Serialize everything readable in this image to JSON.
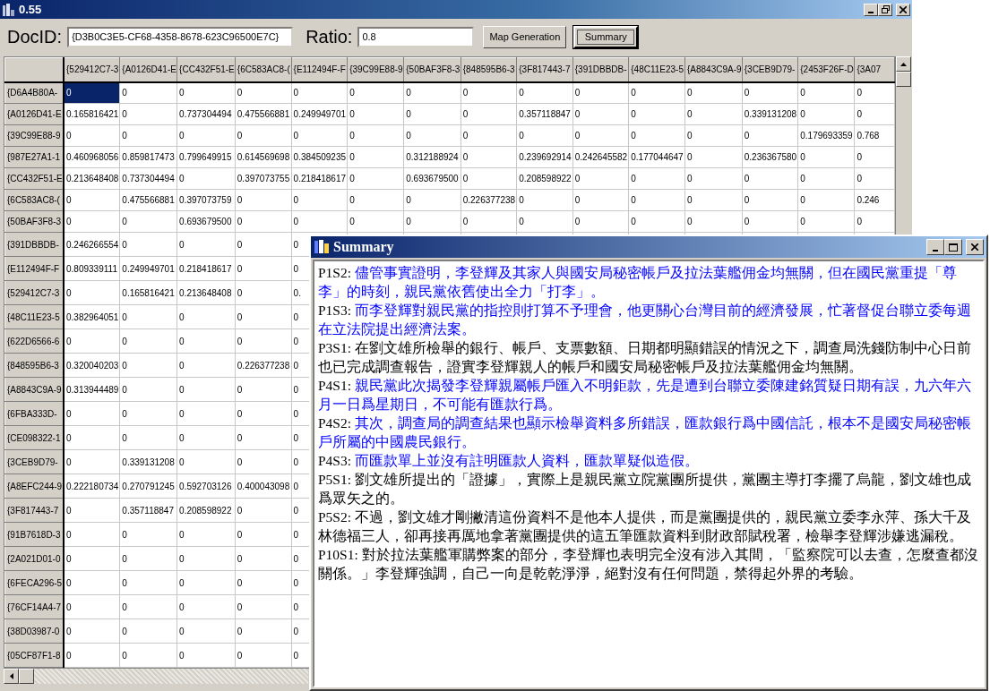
{
  "window": {
    "title": "0.55"
  },
  "toolbar": {
    "docid_label": "DocID:",
    "docid_value": "{D3B0C3E5-CF68-4358-8678-623C96500E7C}",
    "ratio_label": "Ratio:",
    "ratio_value": "0.8",
    "buttons": [
      {
        "label": "Map Generation",
        "focused": false
      },
      {
        "label": "Summary",
        "focused": true
      }
    ]
  },
  "grid": {
    "columns": [
      "{529412C7-3",
      "{A0126D41-E",
      "{CC432F51-E",
      "{6C583AC8-(",
      "{E112494F-F",
      "{39C99E88-9",
      "{50BAF3F8-3",
      "{848595B6-3",
      "{3F817443-7",
      "{391DBBDB-",
      "{48C11E23-5",
      "{A8843C9A-9",
      "{3CEB9D79-",
      "{2453F26F-D",
      "{3A07"
    ],
    "rows": [
      {
        "header": "{D6A4B80A-",
        "cells": [
          {
            "text": "0",
            "selected": true
          },
          {
            "text": "0",
            "selected": false
          },
          {
            "text": "0",
            "selected": false
          },
          {
            "text": "0",
            "selected": false
          },
          {
            "text": "0",
            "selected": false
          },
          {
            "text": "0",
            "selected": false
          },
          {
            "text": "0",
            "selected": false
          },
          {
            "text": "0",
            "selected": false
          },
          {
            "text": "0",
            "selected": false
          },
          {
            "text": "0",
            "selected": false
          },
          {
            "text": "0",
            "selected": false
          },
          {
            "text": "0",
            "selected": false
          },
          {
            "text": "0",
            "selected": false
          },
          {
            "text": "0",
            "selected": false
          },
          {
            "text": "0",
            "selected": false
          }
        ]
      },
      {
        "header": "{A0126D41-E",
        "cells": [
          {
            "text": "0.165816421",
            "selected": false
          },
          {
            "text": "0",
            "selected": false
          },
          {
            "text": "0.737304494",
            "selected": false
          },
          {
            "text": "0.475566881",
            "selected": false
          },
          {
            "text": "0.249949701",
            "selected": false
          },
          {
            "text": "0",
            "selected": false
          },
          {
            "text": "0",
            "selected": false
          },
          {
            "text": "0",
            "selected": false
          },
          {
            "text": "0.357118847",
            "selected": false
          },
          {
            "text": "0",
            "selected": false
          },
          {
            "text": "0",
            "selected": false
          },
          {
            "text": "0",
            "selected": false
          },
          {
            "text": "0.339131208",
            "selected": false
          },
          {
            "text": "0",
            "selected": false
          },
          {
            "text": "0",
            "selected": false
          }
        ]
      },
      {
        "header": "{39C99E88-9",
        "cells": [
          {
            "text": "0",
            "selected": false
          },
          {
            "text": "0",
            "selected": false
          },
          {
            "text": "0",
            "selected": false
          },
          {
            "text": "0",
            "selected": false
          },
          {
            "text": "0",
            "selected": false
          },
          {
            "text": "0",
            "selected": false
          },
          {
            "text": "0",
            "selected": false
          },
          {
            "text": "0",
            "selected": false
          },
          {
            "text": "0",
            "selected": false
          },
          {
            "text": "0",
            "selected": false
          },
          {
            "text": "0",
            "selected": false
          },
          {
            "text": "0",
            "selected": false
          },
          {
            "text": "0",
            "selected": false
          },
          {
            "text": "0.179693359",
            "selected": false
          },
          {
            "text": "0.768",
            "selected": false
          }
        ]
      },
      {
        "header": "{987E27A1-1",
        "cells": [
          {
            "text": "0.460968056",
            "selected": false
          },
          {
            "text": "0.859817473",
            "selected": false
          },
          {
            "text": "0.799649915",
            "selected": false
          },
          {
            "text": "0.614569698",
            "selected": false
          },
          {
            "text": "0.384509235",
            "selected": false
          },
          {
            "text": "0",
            "selected": false
          },
          {
            "text": "0.312188924",
            "selected": false
          },
          {
            "text": "0",
            "selected": false
          },
          {
            "text": "0.239692914",
            "selected": false
          },
          {
            "text": "0.242645582",
            "selected": false
          },
          {
            "text": "0.177044647",
            "selected": false
          },
          {
            "text": "0",
            "selected": false
          },
          {
            "text": "0.236367580",
            "selected": false
          },
          {
            "text": "0",
            "selected": false
          },
          {
            "text": "0",
            "selected": false
          }
        ]
      },
      {
        "header": "{CC432F51-E",
        "cells": [
          {
            "text": "0.213648408",
            "selected": false
          },
          {
            "text": "0.737304494",
            "selected": false
          },
          {
            "text": "0",
            "selected": false
          },
          {
            "text": "0.397073755",
            "selected": false
          },
          {
            "text": "0.218418617",
            "selected": false
          },
          {
            "text": "0",
            "selected": false
          },
          {
            "text": "0.693679500",
            "selected": false
          },
          {
            "text": "0",
            "selected": false
          },
          {
            "text": "0.208598922",
            "selected": false
          },
          {
            "text": "0",
            "selected": false
          },
          {
            "text": "0",
            "selected": false
          },
          {
            "text": "0",
            "selected": false
          },
          {
            "text": "0",
            "selected": false
          },
          {
            "text": "0",
            "selected": false
          },
          {
            "text": "0",
            "selected": false
          }
        ]
      },
      {
        "header": "{6C583AC8-(",
        "cells": [
          {
            "text": "0",
            "selected": false
          },
          {
            "text": "0.475566881",
            "selected": false
          },
          {
            "text": "0.397073759",
            "selected": false
          },
          {
            "text": "0",
            "selected": false
          },
          {
            "text": "0",
            "selected": false
          },
          {
            "text": "0",
            "selected": false
          },
          {
            "text": "0",
            "selected": false
          },
          {
            "text": "0.226377238",
            "selected": false
          },
          {
            "text": "0",
            "selected": false
          },
          {
            "text": "0",
            "selected": false
          },
          {
            "text": "0",
            "selected": false
          },
          {
            "text": "0",
            "selected": false
          },
          {
            "text": "0",
            "selected": false
          },
          {
            "text": "0",
            "selected": false
          },
          {
            "text": "0.246",
            "selected": false
          }
        ]
      },
      {
        "header": "{50BAF3F8-3",
        "cells": [
          {
            "text": "0",
            "selected": false
          },
          {
            "text": "0",
            "selected": false
          },
          {
            "text": "0.693679500",
            "selected": false
          },
          {
            "text": "0",
            "selected": false
          },
          {
            "text": "0",
            "selected": false
          },
          {
            "text": "0",
            "selected": false
          },
          {
            "text": "0",
            "selected": false
          },
          {
            "text": "0",
            "selected": false
          },
          {
            "text": "0",
            "selected": false
          },
          {
            "text": "0",
            "selected": false
          },
          {
            "text": "0",
            "selected": false
          },
          {
            "text": "0",
            "selected": false
          },
          {
            "text": "0",
            "selected": false
          },
          {
            "text": "0",
            "selected": false
          },
          {
            "text": "0",
            "selected": false
          }
        ]
      },
      {
        "header": "{391DBBDB-",
        "cells": [
          {
            "text": "0.246266554",
            "selected": false
          },
          {
            "text": "0",
            "selected": false
          },
          {
            "text": "0",
            "selected": false
          },
          {
            "text": "0",
            "selected": false
          },
          {
            "text": "0",
            "selected": false
          }
        ]
      },
      {
        "header": "{E112494F-F",
        "cells": [
          {
            "text": "0.809339111",
            "selected": false
          },
          {
            "text": "0.249949701",
            "selected": false
          },
          {
            "text": "0.218418617",
            "selected": false
          },
          {
            "text": "0",
            "selected": false
          },
          {
            "text": "0",
            "selected": false
          }
        ]
      },
      {
        "header": "{529412C7-3",
        "cells": [
          {
            "text": "0",
            "selected": false
          },
          {
            "text": "0.165816421",
            "selected": false
          },
          {
            "text": "0.213648408",
            "selected": false
          },
          {
            "text": "0",
            "selected": false
          },
          {
            "text": "0.",
            "selected": false
          }
        ]
      },
      {
        "header": "{48C11E23-5",
        "cells": [
          {
            "text": "0.382964051",
            "selected": false
          },
          {
            "text": "0",
            "selected": false
          },
          {
            "text": "0",
            "selected": false
          },
          {
            "text": "0",
            "selected": false
          },
          {
            "text": "0",
            "selected": false
          }
        ]
      },
      {
        "header": "{622D6566-6",
        "cells": [
          {
            "text": "0",
            "selected": false
          },
          {
            "text": "0",
            "selected": false
          },
          {
            "text": "0",
            "selected": false
          },
          {
            "text": "0",
            "selected": false
          },
          {
            "text": "0",
            "selected": false
          }
        ]
      },
      {
        "header": "{848595B6-3",
        "cells": [
          {
            "text": "0.320040203",
            "selected": false
          },
          {
            "text": "0",
            "selected": false
          },
          {
            "text": "0",
            "selected": false
          },
          {
            "text": "0.226377238",
            "selected": false
          },
          {
            "text": "0",
            "selected": false
          }
        ]
      },
      {
        "header": "{A8843C9A-9",
        "cells": [
          {
            "text": "0.313944489",
            "selected": false
          },
          {
            "text": "0",
            "selected": false
          },
          {
            "text": "0",
            "selected": false
          },
          {
            "text": "0",
            "selected": false
          },
          {
            "text": "0",
            "selected": false
          }
        ]
      },
      {
        "header": "{6FBA333D-",
        "cells": [
          {
            "text": "0",
            "selected": false
          },
          {
            "text": "0",
            "selected": false
          },
          {
            "text": "0",
            "selected": false
          },
          {
            "text": "0",
            "selected": false
          },
          {
            "text": "0",
            "selected": false
          }
        ]
      },
      {
        "header": "{CE098322-1",
        "cells": [
          {
            "text": "0",
            "selected": false
          },
          {
            "text": "0",
            "selected": false
          },
          {
            "text": "0",
            "selected": false
          },
          {
            "text": "0",
            "selected": false
          },
          {
            "text": "0",
            "selected": false
          }
        ]
      },
      {
        "header": "{3CEB9D79-",
        "cells": [
          {
            "text": "0",
            "selected": false
          },
          {
            "text": "0.339131208",
            "selected": false
          },
          {
            "text": "0",
            "selected": false
          },
          {
            "text": "0",
            "selected": false
          },
          {
            "text": "0",
            "selected": false
          }
        ]
      },
      {
        "header": "{A8EFC244-9",
        "cells": [
          {
            "text": "0.222180734",
            "selected": false
          },
          {
            "text": "0.270791245",
            "selected": false
          },
          {
            "text": "0.592703126",
            "selected": false
          },
          {
            "text": "0.400043098",
            "selected": false
          },
          {
            "text": "0",
            "selected": false
          }
        ]
      },
      {
        "header": "{3F817443-7",
        "cells": [
          {
            "text": "0",
            "selected": false
          },
          {
            "text": "0.357118847",
            "selected": false
          },
          {
            "text": "0.208598922",
            "selected": false
          },
          {
            "text": "0",
            "selected": false
          },
          {
            "text": "0",
            "selected": false
          }
        ]
      },
      {
        "header": "{91B7618D-3",
        "cells": [
          {
            "text": "0",
            "selected": false
          },
          {
            "text": "0",
            "selected": false
          },
          {
            "text": "0",
            "selected": false
          },
          {
            "text": "0",
            "selected": false
          },
          {
            "text": "0",
            "selected": false
          }
        ]
      },
      {
        "header": "{2A021D01-0",
        "cells": [
          {
            "text": "0",
            "selected": false
          },
          {
            "text": "0",
            "selected": false
          },
          {
            "text": "0",
            "selected": false
          },
          {
            "text": "0",
            "selected": false
          },
          {
            "text": "0",
            "selected": false
          }
        ]
      },
      {
        "header": "{6FECA296-5",
        "cells": [
          {
            "text": "0",
            "selected": false
          },
          {
            "text": "0",
            "selected": false
          },
          {
            "text": "0",
            "selected": false
          },
          {
            "text": "0",
            "selected": false
          },
          {
            "text": "0",
            "selected": false
          }
        ]
      },
      {
        "header": "{76CF14A4-7",
        "cells": [
          {
            "text": "0",
            "selected": false
          },
          {
            "text": "0",
            "selected": false
          },
          {
            "text": "0",
            "selected": false
          },
          {
            "text": "0",
            "selected": false
          },
          {
            "text": "0",
            "selected": false
          }
        ]
      },
      {
        "header": "{38D03987-0",
        "cells": [
          {
            "text": "0",
            "selected": false
          },
          {
            "text": "0",
            "selected": false
          },
          {
            "text": "0",
            "selected": false
          },
          {
            "text": "0",
            "selected": false
          },
          {
            "text": "0",
            "selected": false
          }
        ]
      },
      {
        "header": "{05CF87F1-8",
        "cells": [
          {
            "text": "0",
            "selected": false
          },
          {
            "text": "0",
            "selected": false
          },
          {
            "text": "0",
            "selected": false
          },
          {
            "text": "0",
            "selected": false
          },
          {
            "text": "0",
            "selected": false
          }
        ]
      }
    ]
  },
  "summary_window": {
    "title": "Summary",
    "sentences": [
      {
        "label": "P1S2:",
        "text": "儘管事實證明，李登輝及其家人與國安局秘密帳戶及拉法葉艦佣金均無關，但在國民黨重提「尊李」的時刻，親民黨依舊使出全力「打李」。",
        "color": "#0000ff"
      },
      {
        "label": "P1S3:",
        "text": "而李登輝對親民黨的指控則打算不予理會，他更關心台灣目前的經濟發展，忙著督促台聯立委每週在立法院提出經濟法案。",
        "color": "#0000ff"
      },
      {
        "label": "P3S1:",
        "text": "在劉文雄所檢舉的銀行、帳戶、支票數額、日期都明顯錯誤的情況之下，調查局洗錢防制中心日前也已完成調查報告，證實李登輝親人的帳戶和國安局秘密帳戶及拉法葉艦佣金均無關。",
        "color": "#000000"
      },
      {
        "label": "P4S1:",
        "text": "親民黨此次揭發李登輝親屬帳戶匯入不明鉅款，先是遭到台聯立委陳建銘質疑日期有誤，九六年六月一日爲星期日，不可能有匯款行爲。",
        "color": "#0000ff"
      },
      {
        "label": "P4S2:",
        "text": "其次，調查局的調查結果也顯示檢舉資料多所錯誤，匯款銀行爲中國信託，根本不是國安局秘密帳戶所屬的中國農民銀行。",
        "color": "#0000ff"
      },
      {
        "label": "P4S3:",
        "text": "而匯款單上並沒有註明匯款人資料，匯款單疑似造假。",
        "color": "#0000ff"
      },
      {
        "label": "P5S1:",
        "text": "劉文雄所提出的「證據」，實際上是親民黨立院黨團所提供，黨團主導打李擺了烏龍，劉文雄也成爲眾矢之的。",
        "color": "#000000"
      },
      {
        "label": "P5S2:",
        "text": "不過，劉文雄才剛撇清這份資料不是他本人提供，而是黨團提供的，親民黨立委李永萍、孫大千及林德福三人，卻再接再厲地拿著黨團提供的這五筆匯款資料到財政部賦稅署，檢舉李登輝涉嫌逃漏稅。",
        "color": "#000000"
      },
      {
        "label": "P10S1:",
        "text": "對於拉法葉艦軍購弊案的部分，李登輝也表明完全沒有涉入其間，「監察院可以去查，怎麼查都沒關係。」李登輝強調，自己一向是乾乾淨淨，絕對沒有任何問題，禁得起外界的考驗。",
        "color": "#000000"
      }
    ]
  }
}
